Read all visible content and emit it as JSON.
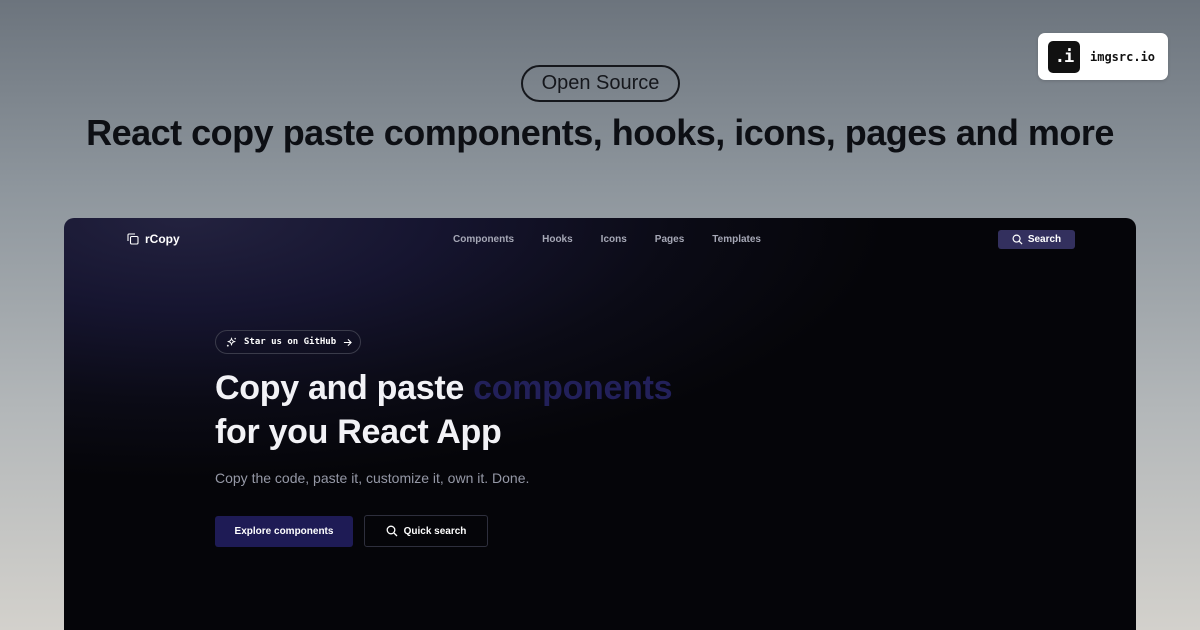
{
  "brand": {
    "logo_text": ".i",
    "name": "imgsrc.io"
  },
  "badge": {
    "label": "Open Source"
  },
  "headline": "React copy paste components, hooks, icons, pages and more",
  "app": {
    "logo_label": "rCopy",
    "nav": [
      {
        "label": "Components"
      },
      {
        "label": "Hooks"
      },
      {
        "label": "Icons"
      },
      {
        "label": "Pages"
      },
      {
        "label": "Templates"
      }
    ],
    "search_label": "Search",
    "hero": {
      "star_label": "Star us on GitHub",
      "title_part1": "Copy and paste ",
      "title_accent": "components",
      "title_line2": "for you React App",
      "subtitle": "Copy the code, paste it, customize it, own it. Done.",
      "primary_button": "Explore components",
      "secondary_button": "Quick search"
    }
  },
  "colors": {
    "accent": "#1e1b55",
    "accent_text": "#22205a",
    "search_button": "#33305e"
  },
  "icons": {
    "brand": "imgsrc-logo",
    "app_logo": "copy-icon",
    "search": "search-icon",
    "sparkle": "sparkle-icon",
    "arrow": "arrow-right-icon"
  }
}
